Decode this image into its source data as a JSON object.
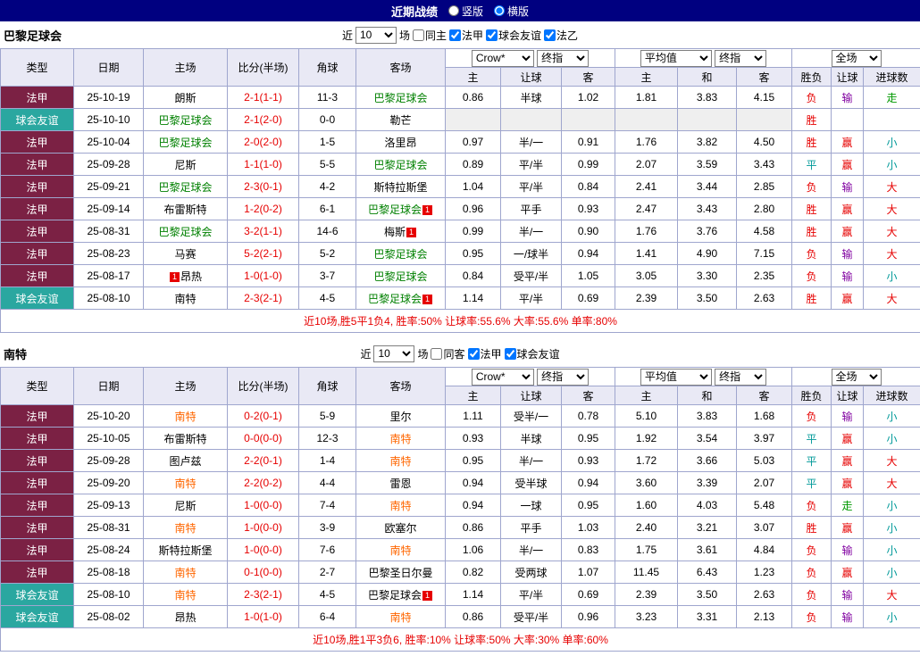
{
  "topbar": {
    "title": "近期战绩",
    "radios": [
      {
        "label": "竖版",
        "checked": false
      },
      {
        "label": "横版",
        "checked": true
      }
    ]
  },
  "colors": {
    "topbar_bg": "#000080",
    "league_type_bg": "#7B2144",
    "friendly_type_bg": "#2AA7A0",
    "win_red": "#E60000",
    "draw_teal": "#009999",
    "push_green": "#009900",
    "lose_purple": "#8000A0",
    "section1_team_highlight": "#008000",
    "section2_team_highlight": "#FF6600",
    "header_bg": "#E9E9F5",
    "table_border": "#9FA6CE"
  },
  "sections": [
    {
      "team": "巴黎足球会",
      "team_color": "#008000",
      "filters": {
        "near_label": "近",
        "count": "10",
        "games_label": "场",
        "checkboxes": [
          {
            "label": "同主",
            "checked": false
          },
          {
            "label": "法甲",
            "checked": true
          },
          {
            "label": "球会友谊",
            "checked": true
          },
          {
            "label": "法乙",
            "checked": true
          }
        ]
      },
      "dropdowns": {
        "company": "Crow*",
        "company_stage": "终指",
        "euro": "平均值",
        "euro_stage": "终指",
        "scope": "全场"
      },
      "headers": [
        "类型",
        "日期",
        "主场",
        "比分(半场)",
        "角球",
        "客场",
        "主",
        "让球",
        "客",
        "主",
        "和",
        "客",
        "胜负",
        "让球",
        "进球数"
      ],
      "rows": [
        [
          "法甲",
          "25-10-19",
          "朗斯",
          "2-1(1-1)",
          "11-3",
          "巴黎足球会",
          "0.86",
          "半球",
          "1.02",
          "1.81",
          "3.83",
          "4.15",
          "负",
          "输",
          "走"
        ],
        [
          "球会友谊",
          "25-10-10",
          "巴黎足球会",
          "2-1(2-0)",
          "0-0",
          "勒芒",
          "",
          "",
          "",
          "",
          "",
          "",
          "胜",
          "",
          ""
        ],
        [
          "法甲",
          "25-10-04",
          "巴黎足球会",
          "2-0(2-0)",
          "1-5",
          "洛里昂",
          "0.97",
          "半/一",
          "0.91",
          "1.76",
          "3.82",
          "4.50",
          "胜",
          "赢",
          "小"
        ],
        [
          "法甲",
          "25-09-28",
          "尼斯",
          "1-1(1-0)",
          "5-5",
          "巴黎足球会",
          "0.89",
          "平/半",
          "0.99",
          "2.07",
          "3.59",
          "3.43",
          "平",
          "赢",
          "小"
        ],
        [
          "法甲",
          "25-09-21",
          "巴黎足球会",
          "2-3(0-1)",
          "4-2",
          "斯特拉斯堡",
          "1.04",
          "平/半",
          "0.84",
          "2.41",
          "3.44",
          "2.85",
          "负",
          "输",
          "大"
        ],
        [
          "法甲",
          "25-09-14",
          "布雷斯特",
          "1-2(0-2)",
          "6-1",
          "巴黎足球会[1]",
          "0.96",
          "平手",
          "0.93",
          "2.47",
          "3.43",
          "2.80",
          "胜",
          "赢",
          "大"
        ],
        [
          "法甲",
          "25-08-31",
          "巴黎足球会",
          "3-2(1-1)",
          "14-6",
          "梅斯[1]",
          "0.99",
          "半/一",
          "0.90",
          "1.76",
          "3.76",
          "4.58",
          "胜",
          "赢",
          "大"
        ],
        [
          "法甲",
          "25-08-23",
          "马赛",
          "5-2(2-1)",
          "5-2",
          "巴黎足球会",
          "0.95",
          "一/球半",
          "0.94",
          "1.41",
          "4.90",
          "7.15",
          "负",
          "输",
          "大"
        ],
        [
          "法甲",
          "25-08-17",
          "[1]昂热",
          "1-0(1-0)",
          "3-7",
          "巴黎足球会",
          "0.84",
          "受平/半",
          "1.05",
          "3.05",
          "3.30",
          "2.35",
          "负",
          "输",
          "小"
        ],
        [
          "球会友谊",
          "25-08-10",
          "南特",
          "2-3(2-1)",
          "4-5",
          "巴黎足球会[1]",
          "1.14",
          "平/半",
          "0.69",
          "2.39",
          "3.50",
          "2.63",
          "胜",
          "赢",
          "大"
        ]
      ],
      "summary": "近10场,胜5平1负4, 胜率:50% 让球率:55.6% 大率:55.6% 单率:80%"
    },
    {
      "team": "南特",
      "team_color": "#FF6600",
      "filters": {
        "near_label": "近",
        "count": "10",
        "games_label": "场",
        "checkboxes": [
          {
            "label": "同客",
            "checked": false
          },
          {
            "label": "法甲",
            "checked": true
          },
          {
            "label": "球会友谊",
            "checked": true
          }
        ]
      },
      "dropdowns": {
        "company": "Crow*",
        "company_stage": "终指",
        "euro": "平均值",
        "euro_stage": "终指",
        "scope": "全场"
      },
      "headers": [
        "类型",
        "日期",
        "主场",
        "比分(半场)",
        "角球",
        "客场",
        "主",
        "让球",
        "客",
        "主",
        "和",
        "客",
        "胜负",
        "让球",
        "进球数"
      ],
      "rows": [
        [
          "法甲",
          "25-10-20",
          "南特",
          "0-2(0-1)",
          "5-9",
          "里尔",
          "1.11",
          "受半/一",
          "0.78",
          "5.10",
          "3.83",
          "1.68",
          "负",
          "输",
          "小"
        ],
        [
          "法甲",
          "25-10-05",
          "布雷斯特",
          "0-0(0-0)",
          "12-3",
          "南特",
          "0.93",
          "半球",
          "0.95",
          "1.92",
          "3.54",
          "3.97",
          "平",
          "赢",
          "小"
        ],
        [
          "法甲",
          "25-09-28",
          "图卢兹",
          "2-2(0-1)",
          "1-4",
          "南特",
          "0.95",
          "半/一",
          "0.93",
          "1.72",
          "3.66",
          "5.03",
          "平",
          "赢",
          "大"
        ],
        [
          "法甲",
          "25-09-20",
          "南特",
          "2-2(0-2)",
          "4-4",
          "雷恩",
          "0.94",
          "受半球",
          "0.94",
          "3.60",
          "3.39",
          "2.07",
          "平",
          "赢",
          "大"
        ],
        [
          "法甲",
          "25-09-13",
          "尼斯",
          "1-0(0-0)",
          "7-4",
          "南特",
          "0.94",
          "一球",
          "0.95",
          "1.60",
          "4.03",
          "5.48",
          "负",
          "走",
          "小"
        ],
        [
          "法甲",
          "25-08-31",
          "南特",
          "1-0(0-0)",
          "3-9",
          "欧塞尔",
          "0.86",
          "平手",
          "1.03",
          "2.40",
          "3.21",
          "3.07",
          "胜",
          "赢",
          "小"
        ],
        [
          "法甲",
          "25-08-24",
          "斯特拉斯堡",
          "1-0(0-0)",
          "7-6",
          "南特",
          "1.06",
          "半/一",
          "0.83",
          "1.75",
          "3.61",
          "4.84",
          "负",
          "输",
          "小"
        ],
        [
          "法甲",
          "25-08-18",
          "南特",
          "0-1(0-0)",
          "2-7",
          "巴黎圣日尔曼",
          "0.82",
          "受两球",
          "1.07",
          "11.45",
          "6.43",
          "1.23",
          "负",
          "赢",
          "小"
        ],
        [
          "球会友谊",
          "25-08-10",
          "南特",
          "2-3(2-1)",
          "4-5",
          "巴黎足球会[1]",
          "1.14",
          "平/半",
          "0.69",
          "2.39",
          "3.50",
          "2.63",
          "负",
          "输",
          "大"
        ],
        [
          "球会友谊",
          "25-08-02",
          "昂热",
          "1-0(1-0)",
          "6-4",
          "南特",
          "0.86",
          "受平/半",
          "0.96",
          "3.23",
          "3.31",
          "2.13",
          "负",
          "输",
          "小"
        ]
      ],
      "summary": "近10场,胜1平3负6, 胜率:10% 让球率:50% 大率:30% 单率:60%"
    }
  ]
}
